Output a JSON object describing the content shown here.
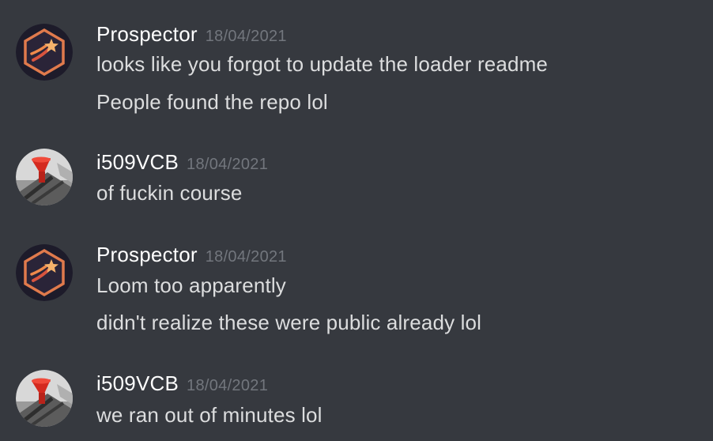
{
  "messages": [
    {
      "author": "Prospector",
      "timestamp": "18/04/2021",
      "avatar_icon": "shooting-star-hexagon-icon",
      "lines": [
        "looks like you forgot to update the loader readme",
        "People found the repo lol"
      ]
    },
    {
      "author": "i509VCB",
      "timestamp": "18/04/2021",
      "avatar_icon": "red-funnel-photo-icon",
      "lines": [
        "of fuckin course"
      ]
    },
    {
      "author": "Prospector",
      "timestamp": "18/04/2021",
      "avatar_icon": "shooting-star-hexagon-icon",
      "lines": [
        "Loom too apparently",
        "didn't realize these were public already lol"
      ]
    },
    {
      "author": "i509VCB",
      "timestamp": "18/04/2021",
      "avatar_icon": "red-funnel-photo-icon",
      "lines": [
        "we ran out of minutes lol"
      ]
    }
  ],
  "colors": {
    "background": "#36393f",
    "username": "#ffffff",
    "timestamp": "#72767d",
    "message_text": "#dcddde"
  }
}
